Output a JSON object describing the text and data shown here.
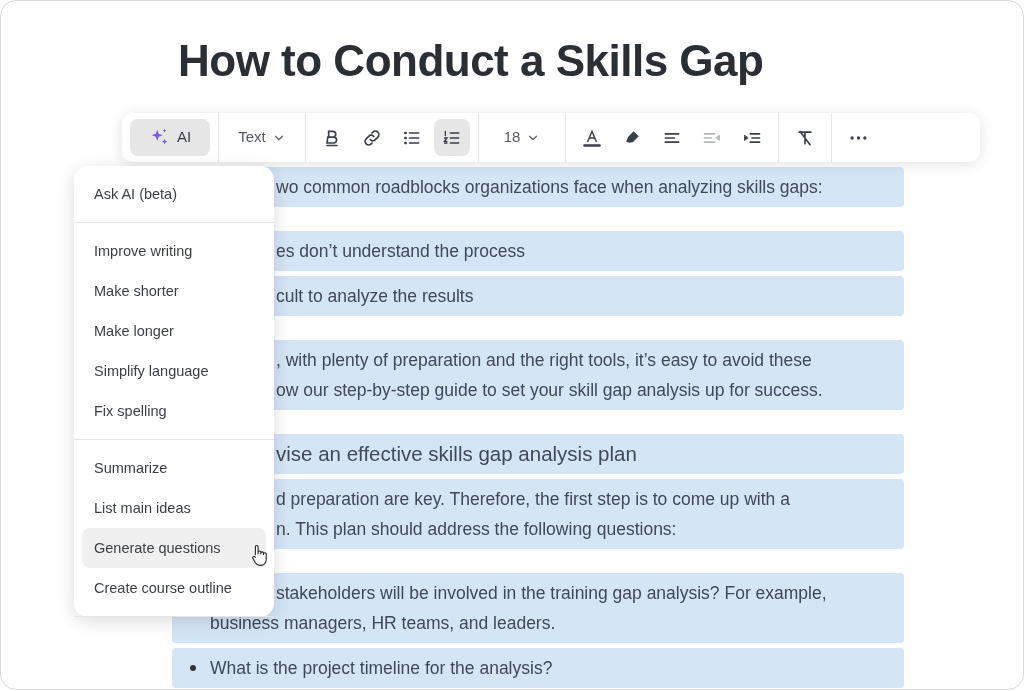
{
  "title": "How to Conduct a Skills Gap",
  "toolbar": {
    "groups": [
      [
        {
          "kind": "ai",
          "label": "AI",
          "selected": true,
          "disabled": false
        }
      ],
      [
        {
          "kind": "dropdown",
          "label": "Text",
          "selected": false,
          "disabled": false
        }
      ],
      [
        {
          "kind": "bold",
          "selected": false,
          "disabled": false
        },
        {
          "kind": "link",
          "selected": false,
          "disabled": false
        },
        {
          "kind": "bullet-list",
          "selected": false,
          "disabled": false
        },
        {
          "kind": "numbered-list",
          "selected": true,
          "disabled": false
        }
      ],
      [
        {
          "kind": "dropdown",
          "label": "18",
          "selected": false,
          "disabled": false
        }
      ],
      [
        {
          "kind": "text-color",
          "selected": false,
          "disabled": false
        },
        {
          "kind": "highlight",
          "selected": false,
          "disabled": false
        },
        {
          "kind": "align-left",
          "selected": false,
          "disabled": false
        },
        {
          "kind": "outdent",
          "selected": false,
          "disabled": true
        },
        {
          "kind": "indent",
          "selected": false,
          "disabled": false
        }
      ],
      [
        {
          "kind": "clear-format",
          "selected": false,
          "disabled": false
        }
      ],
      [
        {
          "kind": "more",
          "selected": false,
          "disabled": false
        }
      ]
    ]
  },
  "ai_menu": {
    "sections": [
      [
        {
          "label": "Ask AI (beta)",
          "selected": false
        }
      ],
      [
        {
          "label": "Improve writing",
          "selected": false
        },
        {
          "label": "Make shorter",
          "selected": false
        },
        {
          "label": "Make longer",
          "selected": false
        },
        {
          "label": "Simplify language",
          "selected": false
        },
        {
          "label": "Fix spelling",
          "selected": false
        }
      ],
      [
        {
          "label": "Summarize",
          "selected": false
        },
        {
          "label": "List main ideas",
          "selected": false
        },
        {
          "label": "Generate questions",
          "selected": true
        },
        {
          "label": "Create course outline",
          "selected": false
        }
      ]
    ]
  },
  "content": [
    [
      {
        "kind": "paragraph",
        "lines": [
          {
            "text": "wo common roadblocks organizations face when analyzing skills gaps:",
            "cut": true
          }
        ]
      }
    ],
    [
      {
        "kind": "paragraph",
        "lines": [
          {
            "text": "es don’t understand the process",
            "cut": true
          }
        ]
      },
      {
        "kind": "paragraph",
        "lines": [
          {
            "text": "cult to analyze the results",
            "cut": true
          }
        ]
      }
    ],
    [
      {
        "kind": "paragraph",
        "lines": [
          {
            "text": ", with plenty of preparation and the right tools, it’s easy to avoid these",
            "cut": true
          },
          {
            "text": "ow our step-by-step guide to set your skill gap analysis up for success.",
            "cut": true
          }
        ]
      }
    ],
    [
      {
        "kind": "heading",
        "lines": [
          {
            "text": "vise an effective skills gap analysis plan",
            "cut": true
          }
        ]
      },
      {
        "kind": "paragraph",
        "lines": [
          {
            "text": "d preparation are key. Therefore, the first step is to come up with a",
            "cut": true
          },
          {
            "text": "n. This plan should address the following questions:",
            "cut": true
          }
        ]
      }
    ],
    [
      {
        "kind": "bullet",
        "lines": [
          {
            "text": "stakeholders will be involved in the training gap analysis? For example,",
            "cut": true
          },
          {
            "text": "business managers, HR teams, and leaders.",
            "cut": false
          }
        ]
      },
      {
        "kind": "bullet",
        "lines": [
          {
            "text": "What is the project timeline for the analysis?",
            "cut": false
          }
        ]
      }
    ]
  ]
}
